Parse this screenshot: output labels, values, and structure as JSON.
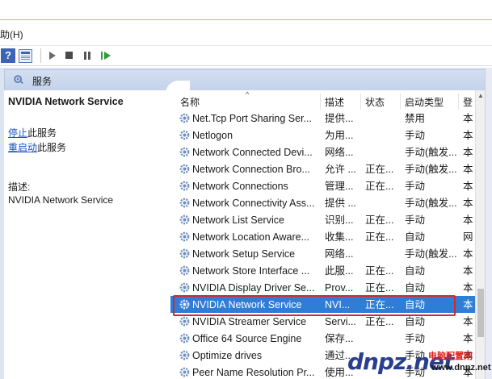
{
  "menu": {
    "help_label": "助(H)"
  },
  "toolbar": {
    "help_icon": "question-icon",
    "help_glyph": "?",
    "buttons": [
      "properties-icon",
      "start-icon",
      "stop-icon",
      "pause-icon",
      "restart-icon"
    ]
  },
  "header": {
    "title": "服务",
    "icon": "services-gear-icon"
  },
  "left_panel": {
    "service_name": "NVIDIA Network Service",
    "stop_link": "停止",
    "stop_suffix": "此服务",
    "restart_link": "重启动",
    "restart_suffix": "此服务",
    "description_label": "描述:",
    "description_value": "NVIDIA Network Service"
  },
  "table": {
    "sort_indicator": "^",
    "columns": {
      "name": "名称",
      "description": "描述",
      "status": "状态",
      "startup_type": "启动类型",
      "logon": "登"
    },
    "rows": [
      {
        "name": "Net.Tcp Port Sharing Ser...",
        "description": "提供...",
        "status": "",
        "startup_type": "禁用",
        "logon": "本"
      },
      {
        "name": "Netlogon",
        "description": "为用...",
        "status": "",
        "startup_type": "手动",
        "logon": "本"
      },
      {
        "name": "Network Connected Devi...",
        "description": "网络...",
        "status": "",
        "startup_type": "手动(触发...",
        "logon": "本"
      },
      {
        "name": "Network Connection Bro...",
        "description": "允许 ...",
        "status": "正在...",
        "startup_type": "手动(触发...",
        "logon": "本"
      },
      {
        "name": "Network Connections",
        "description": "管理...",
        "status": "正在...",
        "startup_type": "手动",
        "logon": "本"
      },
      {
        "name": "Network Connectivity Ass...",
        "description": "提供 ...",
        "status": "",
        "startup_type": "手动(触发...",
        "logon": "本"
      },
      {
        "name": "Network List Service",
        "description": "识别...",
        "status": "正在...",
        "startup_type": "手动",
        "logon": "本"
      },
      {
        "name": "Network Location Aware...",
        "description": "收集...",
        "status": "正在...",
        "startup_type": "自动",
        "logon": "网"
      },
      {
        "name": "Network Setup Service",
        "description": "网络...",
        "status": "",
        "startup_type": "手动(触发...",
        "logon": "本"
      },
      {
        "name": "Network Store Interface ...",
        "description": "此服...",
        "status": "正在...",
        "startup_type": "自动",
        "logon": "本"
      },
      {
        "name": "NVIDIA Display Driver Se...",
        "description": "Prov...",
        "status": "正在...",
        "startup_type": "自动",
        "logon": "本"
      },
      {
        "name": "NVIDIA Network Service",
        "description": "NVI...",
        "status": "正在...",
        "startup_type": "自动",
        "logon": "本",
        "selected": true
      },
      {
        "name": "NVIDIA Streamer Service",
        "description": "Servi...",
        "status": "正在...",
        "startup_type": "自动",
        "logon": "本"
      },
      {
        "name": "Office 64 Source Engine",
        "description": "保存...",
        "status": "",
        "startup_type": "手动",
        "logon": "本"
      },
      {
        "name": "Optimize drives",
        "description": "通过...",
        "status": "",
        "startup_type": "手动",
        "logon": "本"
      },
      {
        "name": "Peer Name Resolution Pr...",
        "description": "使用...",
        "status": "",
        "startup_type": "手动",
        "logon": "本"
      }
    ]
  },
  "watermark": {
    "logo": "dnpz.net",
    "subtitle": "电脑配置网",
    "url": "www.dnpz.net"
  },
  "colors": {
    "selection": "#2e7ed6",
    "highlight_box": "#d9262b",
    "link": "#1b54c0"
  }
}
